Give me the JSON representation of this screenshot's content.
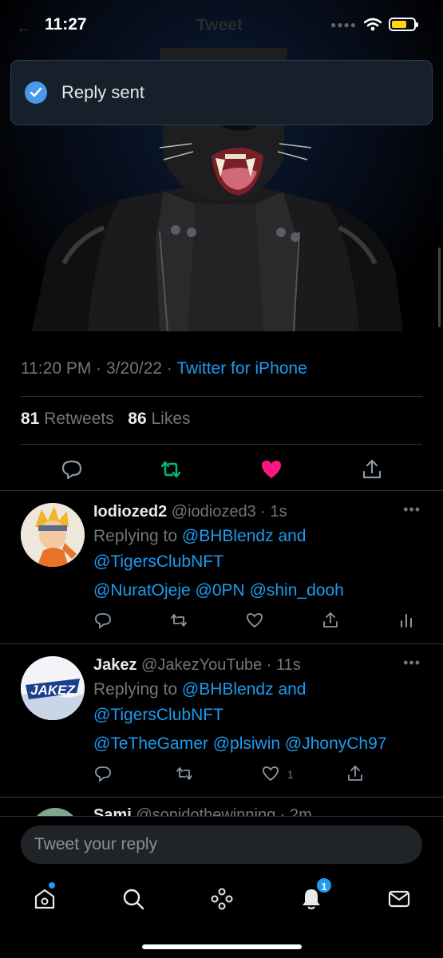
{
  "status_bar": {
    "time": "11:27"
  },
  "header": {
    "title": "Tweet"
  },
  "toast": {
    "text": "Reply sent"
  },
  "tweet": {
    "time": "11:20 PM",
    "date": "3/20/22",
    "source": "Twitter for iPhone",
    "retweets_count": "81",
    "retweets_label": "Retweets",
    "likes_count": "86",
    "likes_label": "Likes"
  },
  "replies": [
    {
      "name": "Iodiozed2",
      "handle": "@iodiozed3",
      "time": "1s",
      "replying_to_label": "Replying to",
      "replying_to_1": "@BHBlendz",
      "and_label": "and",
      "replying_to_2": "@TigersClubNFT",
      "mentions": [
        "@NuratOjeje",
        "@0PN",
        "@shin_dooh"
      ],
      "like_count": ""
    },
    {
      "name": "Jakez",
      "handle": "@JakezYouTube",
      "time": "11s",
      "replying_to_label": "Replying to",
      "replying_to_1": "@BHBlendz",
      "and_label": "and",
      "replying_to_2": "@TigersClubNFT",
      "mentions": [
        "@TeTheGamer",
        "@plsiwin",
        "@JhonyCh97"
      ],
      "like_count": "1"
    }
  ],
  "peek_reply": {
    "name": "Sami",
    "handle": "@sonidothewinning",
    "time": "2m"
  },
  "compose": {
    "placeholder": "Tweet your reply"
  },
  "tabbar": {
    "notifications_badge": "1"
  },
  "colors": {
    "accent": "#1d9bf0",
    "like": "#f91880",
    "retweet": "#00ba7c",
    "background": "#000000"
  }
}
